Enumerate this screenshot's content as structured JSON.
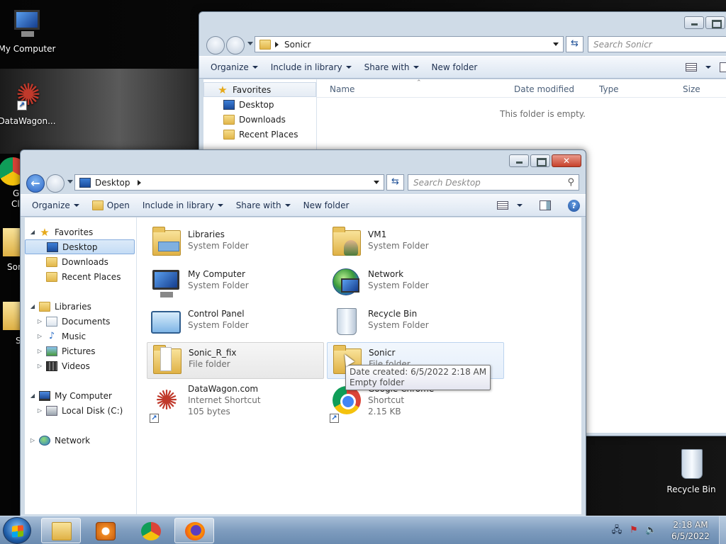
{
  "desktop": {
    "icons": [
      {
        "label": "My Computer",
        "icon": "computer-icon"
      },
      {
        "label": "DataWagon...",
        "icon": "datawagon-icon"
      },
      {
        "label": "G",
        "icon": "chrome-icon"
      },
      {
        "label": "Cl",
        "icon": "chrome-icon"
      },
      {
        "label": "Son",
        "icon": "folder-icon"
      },
      {
        "label": "S",
        "icon": "folder-icon"
      },
      {
        "label": "Recycle Bin",
        "icon": "recycle-bin-icon"
      }
    ]
  },
  "back_window": {
    "breadcrumb": "Sonicr",
    "search_placeholder": "Search Sonicr",
    "toolbar": {
      "organize": "Organize",
      "include": "Include in library",
      "share": "Share with",
      "new_folder": "New folder"
    },
    "nav": {
      "favorites": "Favorites",
      "desktop": "Desktop",
      "downloads": "Downloads",
      "recent": "Recent Places"
    },
    "columns": {
      "name": "Name",
      "date": "Date modified",
      "type": "Type",
      "size": "Size"
    },
    "empty_message": "This folder is empty."
  },
  "front_window": {
    "breadcrumb": "Desktop",
    "search_placeholder": "Search Desktop",
    "toolbar": {
      "organize": "Organize",
      "open": "Open",
      "include": "Include in library",
      "share": "Share with",
      "new_folder": "New folder"
    },
    "nav": {
      "favorites": "Favorites",
      "desktop": "Desktop",
      "downloads": "Downloads",
      "recent": "Recent Places",
      "libraries": "Libraries",
      "documents": "Documents",
      "music": "Music",
      "pictures": "Pictures",
      "videos": "Videos",
      "my_computer": "My Computer",
      "local_disk": "Local Disk (C:)",
      "network": "Network"
    },
    "items": [
      {
        "name": "Libraries",
        "sub": "System Folder",
        "icon": "libraries-icon"
      },
      {
        "name": "VM1",
        "sub": "System Folder",
        "icon": "user-folder-icon"
      },
      {
        "name": "My Computer",
        "sub": "System Folder",
        "icon": "computer-icon"
      },
      {
        "name": "Network",
        "sub": "System Folder",
        "icon": "network-icon"
      },
      {
        "name": "Control Panel",
        "sub": "System Folder",
        "icon": "control-panel-icon"
      },
      {
        "name": "Recycle Bin",
        "sub": "System Folder",
        "icon": "recycle-bin-icon"
      },
      {
        "name": "Sonic_R_fix",
        "sub": "File folder",
        "icon": "folder-icon"
      },
      {
        "name": "Sonicr",
        "sub": "File folder",
        "icon": "folder-icon"
      },
      {
        "name": "DataWagon.com",
        "sub": "Internet Shortcut",
        "sub2": "105 bytes",
        "icon": "datawagon-icon"
      },
      {
        "name": "Google Chrome",
        "sub": "Shortcut",
        "sub2": "2.15 KB",
        "icon": "chrome-icon"
      }
    ],
    "tooltip": {
      "line1": "Date created: 6/5/2022 2:18 AM",
      "line2": "Empty folder"
    }
  },
  "taskbar": {
    "pinned": [
      "windows-explorer-icon",
      "media-player-icon",
      "chrome-icon",
      "firefox-icon"
    ],
    "clock_time": "2:18 AM",
    "clock_date": "6/5/2022"
  }
}
